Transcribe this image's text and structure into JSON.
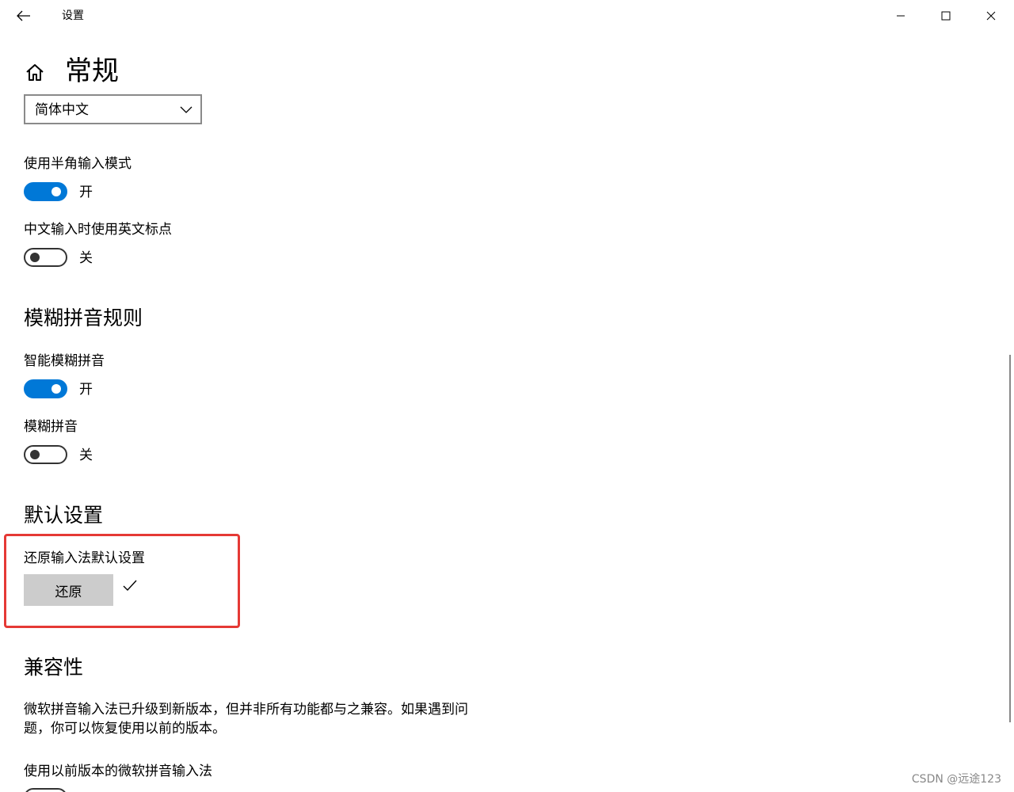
{
  "window": {
    "title": "设置"
  },
  "page": {
    "title": "常规"
  },
  "language_dropdown": {
    "value": "简体中文"
  },
  "settings": {
    "half_width": {
      "label": "使用半角输入模式",
      "state": "开",
      "on": true
    },
    "english_punct": {
      "label": "中文输入时使用英文标点",
      "state": "关",
      "on": false
    }
  },
  "fuzzy_section": {
    "heading": "模糊拼音规则",
    "smart_fuzzy": {
      "label": "智能模糊拼音",
      "state": "开",
      "on": true
    },
    "fuzzy": {
      "label": "模糊拼音",
      "state": "关",
      "on": false
    }
  },
  "defaults_section": {
    "heading": "默认设置",
    "restore_label": "还原输入法默认设置",
    "restore_button": "还原"
  },
  "compat_section": {
    "heading": "兼容性",
    "paragraph": "微软拼音输入法已升级到新版本，但并非所有功能都与之兼容。如果遇到问题，你可以恢复使用以前的版本。",
    "legacy_label": "使用以前版本的微软拼音输入法"
  },
  "watermark": "CSDN @远途123",
  "colors": {
    "accent": "#0078d7",
    "highlight": "#e53935"
  }
}
